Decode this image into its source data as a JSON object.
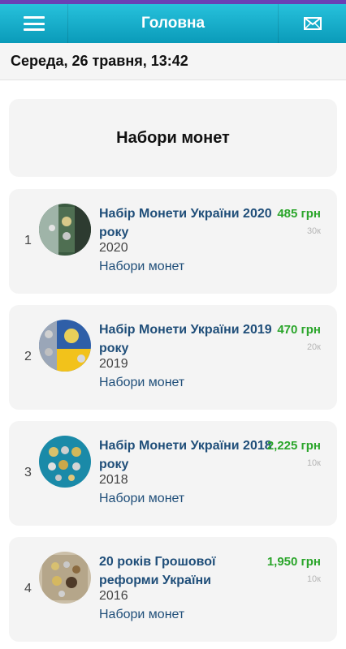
{
  "header": {
    "title": "Головна",
    "menu_icon": "hamburger-menu-icon",
    "mail_icon": "envelope-icon",
    "color": "#0fa8c6",
    "accent_line": "#6a3fb5"
  },
  "datebar": {
    "text": "Середа, 26 травня, 13:42"
  },
  "section": {
    "title": "Набори монет"
  },
  "items": [
    {
      "index": "1",
      "title": "Набір Монети України 2020 року",
      "year": "2020",
      "category": "Набори монет",
      "price": "485 грн",
      "views": "30к"
    },
    {
      "index": "2",
      "title": "Набір Монети України 2019 року",
      "year": "2019",
      "category": "Набори монет",
      "price": "470 грн",
      "views": "20к"
    },
    {
      "index": "3",
      "title": "Набір Монети України 2018 року",
      "year": "2018",
      "category": "Набори монет",
      "price": "2,225 грн",
      "views": "10к"
    },
    {
      "index": "4",
      "title": "20 років Грошової реформи України",
      "year": "2016",
      "category": "Набори монет",
      "price": "1,950 грн",
      "views": "10к"
    }
  ]
}
